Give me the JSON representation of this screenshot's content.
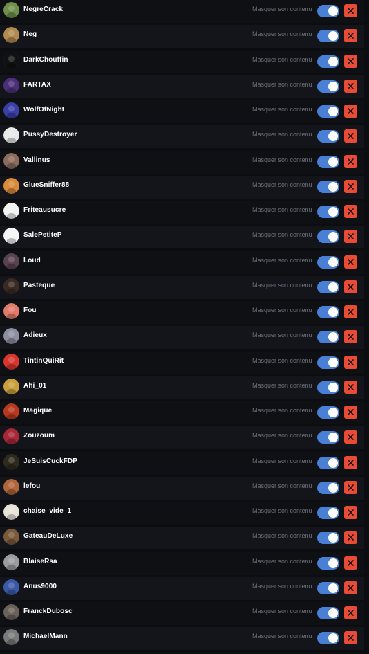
{
  "mask_label": "Masquer son contenu",
  "accent_colors": {
    "toggle_on": "#4a7fd6",
    "remove_button": "#e84c36",
    "row_even": "#14151a",
    "row_odd": "#0f1014"
  },
  "users": [
    {
      "name": "NegreCrack",
      "avatar_color": "#6f8f4a",
      "muted": true
    },
    {
      "name": "Neg",
      "avatar_color": "#b08a4e",
      "muted": true
    },
    {
      "name": "DarkChouffin",
      "avatar_color": "#111111",
      "muted": true
    },
    {
      "name": "FARTAX",
      "avatar_color": "#4b2f7a",
      "muted": true
    },
    {
      "name": "WolfOfNight",
      "avatar_color": "#3b3fa8",
      "muted": true
    },
    {
      "name": "PussyDestroyer",
      "avatar_color": "#e8e8e8",
      "muted": true
    },
    {
      "name": "Vallinus",
      "avatar_color": "#8a6b5c",
      "muted": true
    },
    {
      "name": "GlueSniffer88",
      "avatar_color": "#d98a3a",
      "muted": true
    },
    {
      "name": "Friteausucre",
      "avatar_color": "#f2f2f2",
      "muted": true
    },
    {
      "name": "SalePetiteP",
      "avatar_color": "#f5f5f5",
      "muted": true
    },
    {
      "name": "Loud",
      "avatar_color": "#5a4350",
      "muted": true
    },
    {
      "name": "Pasteque",
      "avatar_color": "#3a2a22",
      "muted": true
    },
    {
      "name": "Fou",
      "avatar_color": "#e07a6a",
      "muted": true
    },
    {
      "name": "Adieux",
      "avatar_color": "#8c8fa0",
      "muted": true
    },
    {
      "name": "TintinQuiRit",
      "avatar_color": "#d8352e",
      "muted": true
    },
    {
      "name": "Ahi_01",
      "avatar_color": "#c9a03c",
      "muted": true
    },
    {
      "name": "Magique",
      "avatar_color": "#b8381e",
      "muted": true
    },
    {
      "name": "Zouzoum",
      "avatar_color": "#a8283a",
      "muted": true
    },
    {
      "name": "JeSuisCuckFDP",
      "avatar_color": "#2e2a1e",
      "muted": true
    },
    {
      "name": "lefou",
      "avatar_color": "#b0653a",
      "muted": true
    },
    {
      "name": "chaise_vide_1",
      "avatar_color": "#e8e2d8",
      "muted": true
    },
    {
      "name": "GateauDeLuxe",
      "avatar_color": "#7a5a3a",
      "muted": true
    },
    {
      "name": "BlaiseRsa",
      "avatar_color": "#9a9aa0",
      "muted": true
    },
    {
      "name": "Anus9000",
      "avatar_color": "#3a5aa8",
      "muted": true
    },
    {
      "name": "FranckDubosc",
      "avatar_color": "#6a625a",
      "muted": true
    },
    {
      "name": "MichaelMann",
      "avatar_color": "#7a7a7a",
      "muted": true
    }
  ]
}
